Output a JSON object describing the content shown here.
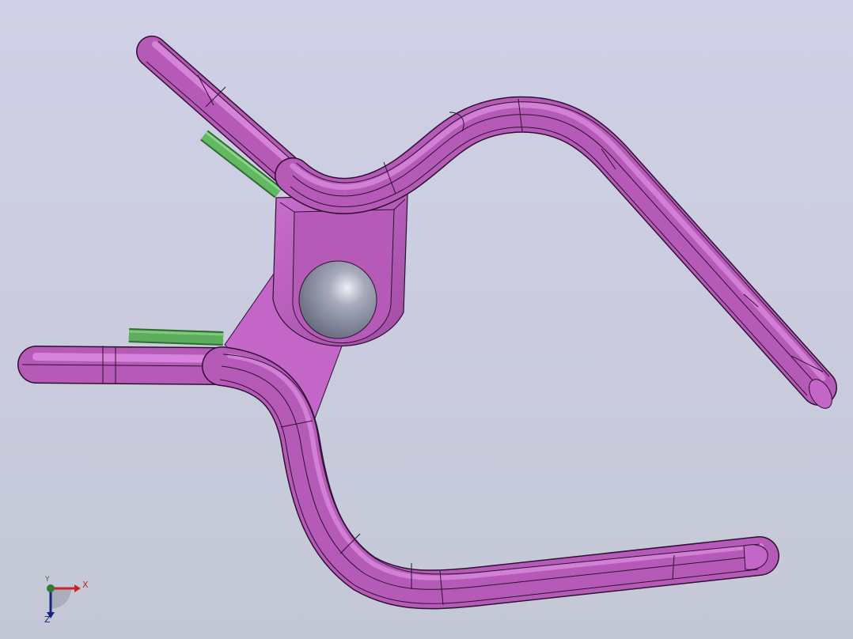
{
  "viewport": {
    "background_top": "#d0d0e6",
    "background_bottom": "#c4c8d6"
  },
  "model": {
    "body_color": "#b65ab8",
    "body_highlight": "#e9a0ec",
    "body_shadow": "#8a3a8e",
    "edge_color": "#2e1030",
    "pin_color": "#5cae5c",
    "pivot_ball_color": "#8c90a2"
  },
  "triad": {
    "x_label": "X",
    "y_label": "Y",
    "z_label": "Z",
    "x_color": "#c62828",
    "y_color": "#2e7d32",
    "z_color": "#1a237e"
  }
}
